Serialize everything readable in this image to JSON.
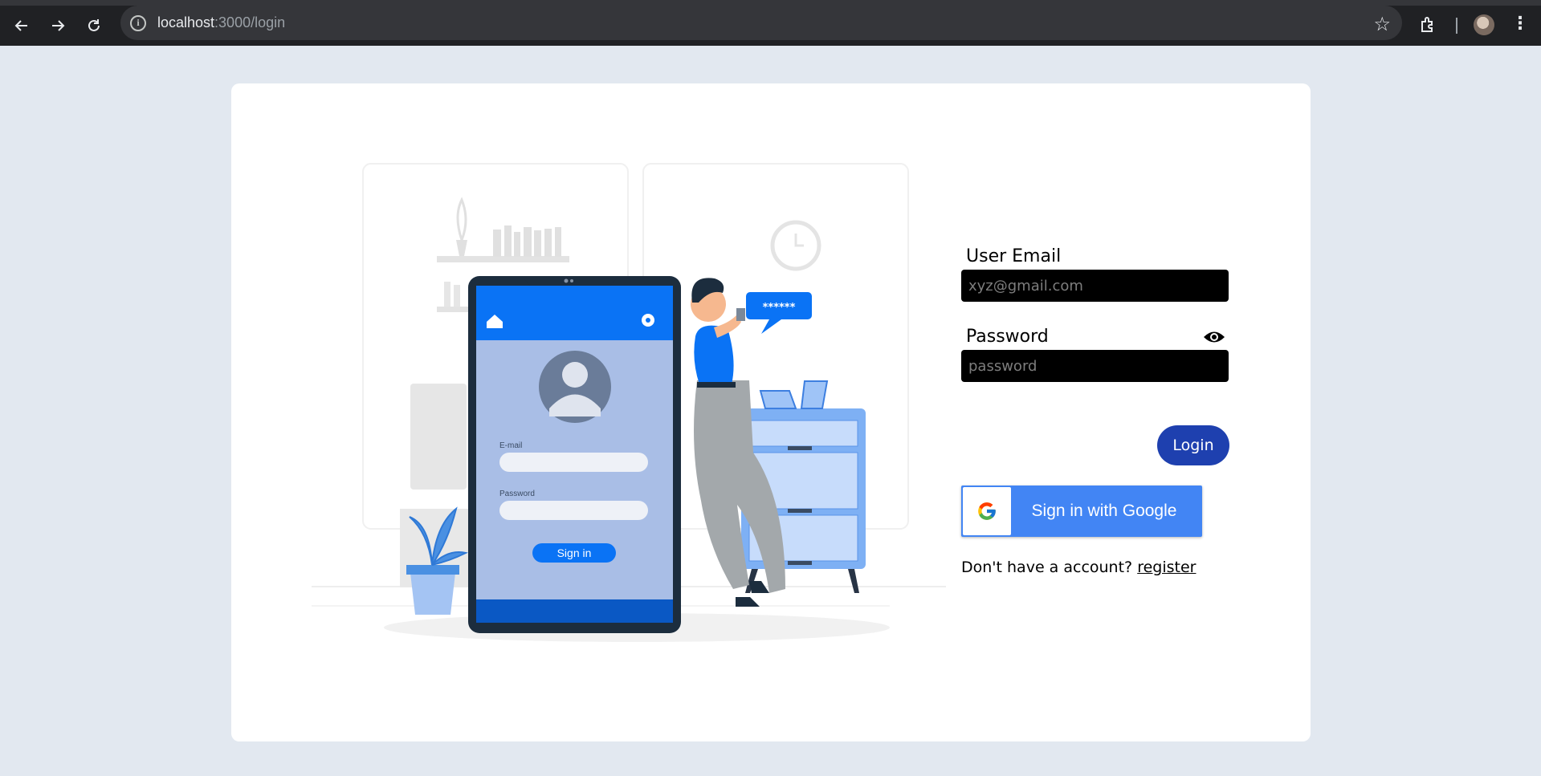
{
  "browser": {
    "url_host": "localhost",
    "url_path": ":3000/login"
  },
  "illustration": {
    "phone_email_label": "E-mail",
    "phone_password_label": "Password",
    "phone_signin_label": "Sign in",
    "bubble_text": "******"
  },
  "form": {
    "email_label": "User Email",
    "email_placeholder": "xyz@gmail.com",
    "password_label": "Password",
    "password_placeholder": "password",
    "login_label": "Login",
    "google_label": "Sign in with Google",
    "signup_prompt": "Don't have a account?",
    "register_link": "register"
  },
  "colors": {
    "accent": "#1e40af",
    "google_blue": "#4285f4",
    "page_bg": "#e2e8f0"
  }
}
